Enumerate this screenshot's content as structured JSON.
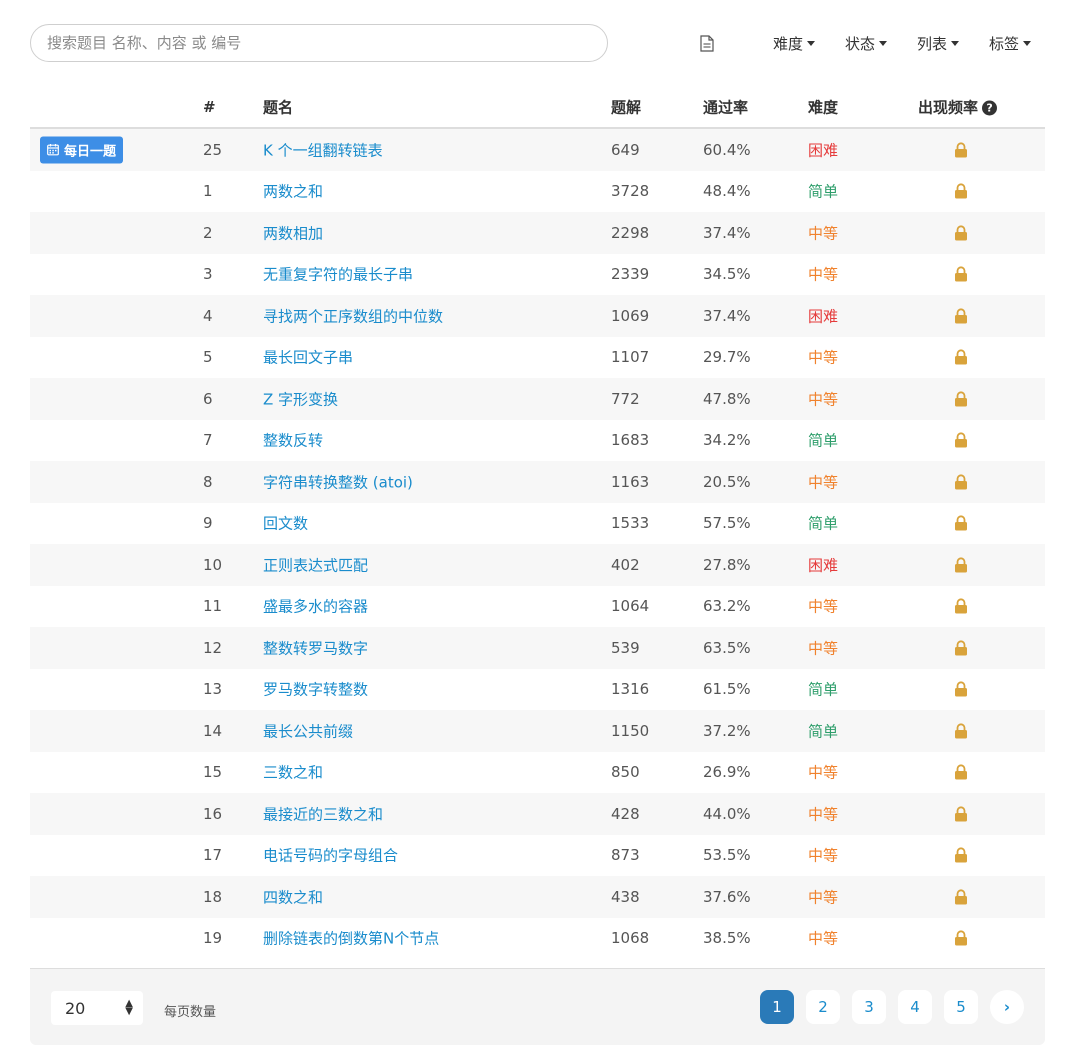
{
  "search": {
    "placeholder": "搜索题目 名称、内容 或 编号"
  },
  "filters": {
    "icon": "document-icon",
    "items": [
      {
        "label": "难度"
      },
      {
        "label": "状态"
      },
      {
        "label": "列表"
      },
      {
        "label": "标签"
      }
    ]
  },
  "table": {
    "headers": {
      "num": "#",
      "title": "题名",
      "solutions": "题解",
      "rate": "通过率",
      "difficulty": "难度",
      "frequency": "出现频率",
      "frequency_help": "?"
    },
    "daily_badge": "每日一题",
    "rows": [
      {
        "num": "25",
        "title": "K 个一组翻转链表",
        "solutions": "649",
        "rate": "60.4%",
        "difficulty": "困难",
        "level": "hard",
        "daily": true
      },
      {
        "num": "1",
        "title": "两数之和",
        "solutions": "3728",
        "rate": "48.4%",
        "difficulty": "简单",
        "level": "easy"
      },
      {
        "num": "2",
        "title": "两数相加",
        "solutions": "2298",
        "rate": "37.4%",
        "difficulty": "中等",
        "level": "medium"
      },
      {
        "num": "3",
        "title": "无重复字符的最长子串",
        "solutions": "2339",
        "rate": "34.5%",
        "difficulty": "中等",
        "level": "medium"
      },
      {
        "num": "4",
        "title": "寻找两个正序数组的中位数",
        "solutions": "1069",
        "rate": "37.4%",
        "difficulty": "困难",
        "level": "hard"
      },
      {
        "num": "5",
        "title": "最长回文子串",
        "solutions": "1107",
        "rate": "29.7%",
        "difficulty": "中等",
        "level": "medium"
      },
      {
        "num": "6",
        "title": "Z 字形变换",
        "solutions": "772",
        "rate": "47.8%",
        "difficulty": "中等",
        "level": "medium"
      },
      {
        "num": "7",
        "title": "整数反转",
        "solutions": "1683",
        "rate": "34.2%",
        "difficulty": "简单",
        "level": "easy"
      },
      {
        "num": "8",
        "title": "字符串转换整数 (atoi)",
        "solutions": "1163",
        "rate": "20.5%",
        "difficulty": "中等",
        "level": "medium"
      },
      {
        "num": "9",
        "title": "回文数",
        "solutions": "1533",
        "rate": "57.5%",
        "difficulty": "简单",
        "level": "easy"
      },
      {
        "num": "10",
        "title": "正则表达式匹配",
        "solutions": "402",
        "rate": "27.8%",
        "difficulty": "困难",
        "level": "hard"
      },
      {
        "num": "11",
        "title": "盛最多水的容器",
        "solutions": "1064",
        "rate": "63.2%",
        "difficulty": "中等",
        "level": "medium"
      },
      {
        "num": "12",
        "title": "整数转罗马数字",
        "solutions": "539",
        "rate": "63.5%",
        "difficulty": "中等",
        "level": "medium"
      },
      {
        "num": "13",
        "title": "罗马数字转整数",
        "solutions": "1316",
        "rate": "61.5%",
        "difficulty": "简单",
        "level": "easy"
      },
      {
        "num": "14",
        "title": "最长公共前缀",
        "solutions": "1150",
        "rate": "37.2%",
        "difficulty": "简单",
        "level": "easy"
      },
      {
        "num": "15",
        "title": "三数之和",
        "solutions": "850",
        "rate": "26.9%",
        "difficulty": "中等",
        "level": "medium"
      },
      {
        "num": "16",
        "title": "最接近的三数之和",
        "solutions": "428",
        "rate": "44.0%",
        "difficulty": "中等",
        "level": "medium"
      },
      {
        "num": "17",
        "title": "电话号码的字母组合",
        "solutions": "873",
        "rate": "53.5%",
        "difficulty": "中等",
        "level": "medium"
      },
      {
        "num": "18",
        "title": "四数之和",
        "solutions": "438",
        "rate": "37.6%",
        "difficulty": "中等",
        "level": "medium"
      },
      {
        "num": "19",
        "title": "删除链表的倒数第N个节点",
        "solutions": "1068",
        "rate": "38.5%",
        "difficulty": "中等",
        "level": "medium"
      }
    ]
  },
  "footer": {
    "per_page_value": "20",
    "per_page_label": "每页数量",
    "pages": [
      "1",
      "2",
      "3",
      "4",
      "5"
    ],
    "current_page": "1",
    "next_label": "›"
  },
  "colors": {
    "link": "#1a8ccc",
    "easy": "#2e9e6b",
    "medium": "#f0822d",
    "hard": "#e53b3b",
    "lock": "#d9a33b",
    "badge": "#3d8ee6",
    "active_page": "#2a7ab8"
  }
}
